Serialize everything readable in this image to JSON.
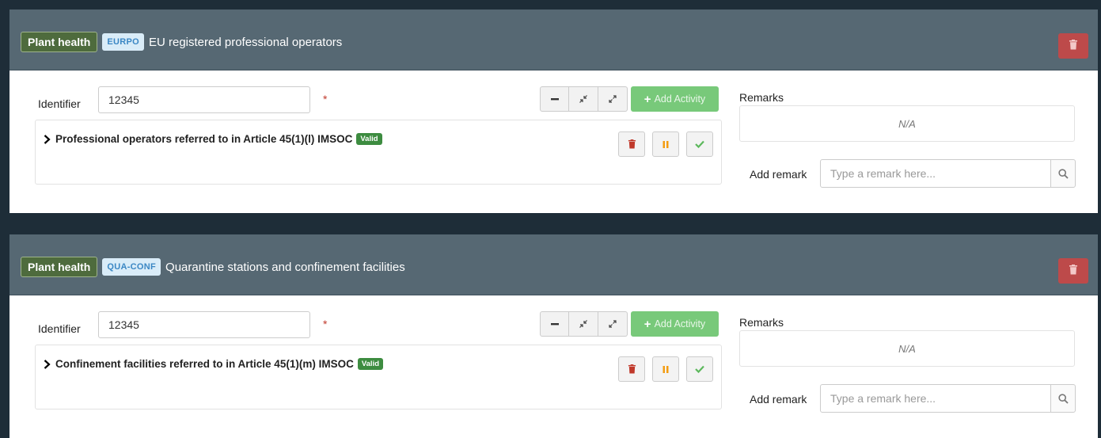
{
  "sections": [
    {
      "domain_label": "Plant health",
      "code": "EURPO",
      "title": "EU registered professional operators",
      "identifier_label": "Identifier",
      "identifier_value": "12345",
      "required_mark": "*",
      "add_activity_label": "Add Activity",
      "activity_title": "Professional operators referred to in Article 45(1)(l) IMSOC",
      "activity_status": "Valid",
      "remarks_label": "Remarks",
      "remarks_value": "N/A",
      "add_remark_label": "Add remark",
      "remark_placeholder": "Type a remark here..."
    },
    {
      "domain_label": "Plant health",
      "code": "QUA-CONF",
      "title": "Quarantine stations and confinement facilities",
      "identifier_label": "Identifier",
      "identifier_value": "12345",
      "required_mark": "*",
      "add_activity_label": "Add Activity",
      "activity_title": "Confinement facilities referred to in Article 45(1)(m) IMSOC",
      "activity_status": "Valid",
      "remarks_label": "Remarks",
      "remarks_value": "N/A",
      "add_remark_label": "Add remark",
      "remark_placeholder": "Type a remark here..."
    }
  ],
  "icons": {
    "delete": "trash-icon",
    "collapse": "minus-icon",
    "compress": "compress-icon",
    "expand": "expand-icon",
    "add": "plus-icon",
    "pause": "pause-icon",
    "validate": "check-icon",
    "chevron": "chevron-right-icon",
    "search": "search-icon"
  },
  "colors": {
    "header_bg": "#566873",
    "domain_badge_bg": "#4e6b3d",
    "code_badge_bg": "#d9ecf8",
    "code_badge_text": "#3b87c4",
    "delete_button_bg": "#bd4a4a",
    "add_activity_bg": "#78c97a",
    "valid_badge_bg": "#3d8c40",
    "page_bg": "#1e2d38"
  }
}
